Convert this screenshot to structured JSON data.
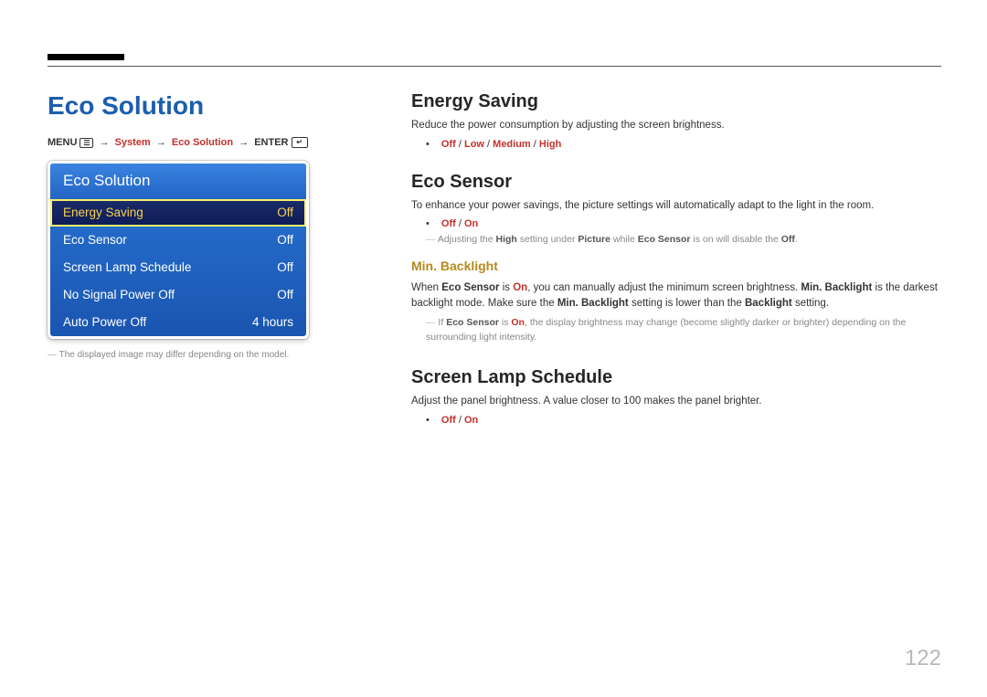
{
  "page_number": "122",
  "left": {
    "title": "Eco Solution",
    "breadcrumb": {
      "menu_word": "MENU",
      "system": "System",
      "eco": "Eco Solution",
      "enter_word": "ENTER",
      "arrow": "→"
    },
    "menu": {
      "title": "Eco Solution",
      "items": [
        {
          "label": "Energy Saving",
          "value": "Off",
          "selected": true
        },
        {
          "label": "Eco Sensor",
          "value": "Off",
          "selected": false
        },
        {
          "label": "Screen Lamp Schedule",
          "value": "Off",
          "selected": false
        },
        {
          "label": "No Signal Power Off",
          "value": "Off",
          "selected": false
        },
        {
          "label": "Auto Power Off",
          "value": "4 hours",
          "selected": false
        }
      ]
    },
    "footnote": "The displayed image may differ depending on the model."
  },
  "right": {
    "energy_saving": {
      "heading": "Energy Saving",
      "desc": "Reduce the power consumption by adjusting the screen brightness.",
      "options": {
        "o1": "Off",
        "o2": "Low",
        "o3": "Medium",
        "o4": "High"
      }
    },
    "eco_sensor": {
      "heading": "Eco Sensor",
      "desc": "To enhance your power savings, the picture settings will automatically adapt to the light in the room.",
      "options": {
        "o1": "Off",
        "o2": "On"
      },
      "note1_pre": "Adjusting the ",
      "note1_high": "High",
      "note1_mid1": " setting under ",
      "note1_picture": "Picture",
      "note1_mid2": " while ",
      "note1_eco": "Eco Sensor",
      "note1_mid3": " is on will disable the ",
      "note1_off": "Off",
      "note1_end": ".",
      "min_backlight": {
        "heading": "Min. Backlight",
        "p1_pre": "When ",
        "p1_eco": "Eco Sensor",
        "p1_mid1": " is ",
        "p1_on": "On",
        "p1_mid2": ", you can manually adjust the minimum screen brightness. ",
        "p1_mb": "Min. Backlight",
        "p1_mid3": " is the darkest backlight mode. Make sure the ",
        "p1_mb2": "Min. Backlight",
        "p1_mid4": " setting is lower than the ",
        "p1_bl": "Backlight",
        "p1_end": " setting.",
        "note2_pre": "If ",
        "note2_eco": "Eco Sensor",
        "note2_mid1": " is ",
        "note2_on": "On",
        "note2_end": ", the display brightness may change (become slightly darker or brighter) depending on the surrounding light intensity."
      }
    },
    "screen_lamp": {
      "heading": "Screen Lamp Schedule",
      "desc": "Adjust the panel brightness. A value closer to 100 makes the panel brighter.",
      "options": {
        "o1": "Off",
        "o2": "On"
      }
    }
  }
}
